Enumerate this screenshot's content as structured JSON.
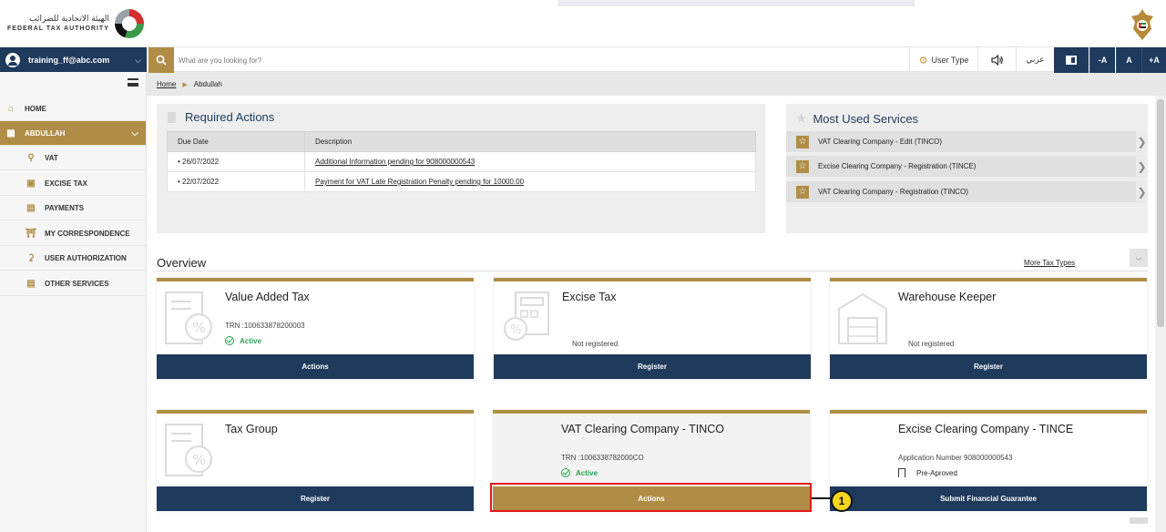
{
  "header": {
    "logo_arabic": "الهيئة الاتحادية للضرائب",
    "logo_english": "FEDERAL TAX AUTHORITY"
  },
  "navbar": {
    "user_email": "training_ff@abc.com",
    "search_placeholder": "What are you looking for?",
    "user_type_label": "User Type",
    "language_label": "عربي",
    "font_decrease": "-A",
    "font_normal": "A",
    "font_increase": "+A"
  },
  "sidebar": {
    "items": [
      {
        "label": "HOME",
        "icon": "home-icon"
      },
      {
        "label": "ABDULLAH",
        "icon": "grid-icon"
      },
      {
        "label": "VAT",
        "icon": "vat-icon"
      },
      {
        "label": "EXCISE TAX",
        "icon": "excise-icon"
      },
      {
        "label": "PAYMENTS",
        "icon": "payments-icon"
      },
      {
        "label": "MY CORRESPONDENCE",
        "icon": "correspondence-icon"
      },
      {
        "label": "USER AUTHORIZATION",
        "icon": "user-auth-icon"
      },
      {
        "label": "OTHER SERVICES",
        "icon": "other-services-icon"
      }
    ]
  },
  "breadcrumb": {
    "home": "Home",
    "current": "Abdullah"
  },
  "required_actions": {
    "title": "Required Actions",
    "headers": [
      "Due Date",
      "Description"
    ],
    "rows": [
      {
        "date": "• 26/07/2022",
        "description": "Additional Information pending for 908000000543"
      },
      {
        "date": "• 22/07/2022",
        "description": "Payment for VAT Late Registration Penalty pending for 10000.00"
      }
    ]
  },
  "most_used": {
    "title": "Most Used Services",
    "items": [
      "VAT Clearing Company - Edit (TINCO)",
      "Excise Clearing Company - Registration (TINCE)",
      "VAT Clearing Company - Registration (TINCO)"
    ]
  },
  "overview": {
    "title": "Overview",
    "more_link": "More Tax Types",
    "cards": [
      {
        "title": "Value Added Tax",
        "line1": "TRN :100633878200003",
        "status": "Active",
        "button": "Actions"
      },
      {
        "title": "Excise Tax",
        "line1": "Not registered",
        "button": "Register"
      },
      {
        "title": "Warehouse Keeper",
        "line1": "Not registered",
        "button": "Register"
      },
      {
        "title": "Tax Group",
        "button": "Register"
      },
      {
        "title": "VAT Clearing Company - TINCO",
        "line1": "TRN :1006338782000CO",
        "status": "Active",
        "button": "Actions"
      },
      {
        "title": "Excise Clearing Company - TINCE",
        "line1": "Application Number 908000000543",
        "status": "Pre-Aproved",
        "button": "Submit Financial Guarantee"
      }
    ]
  },
  "callout": {
    "number": "1"
  },
  "colors": {
    "navy": "#1e3a5c",
    "gold": "#b08d46",
    "active_green": "#2aa44f",
    "highlight_red": "#e21b1b"
  }
}
